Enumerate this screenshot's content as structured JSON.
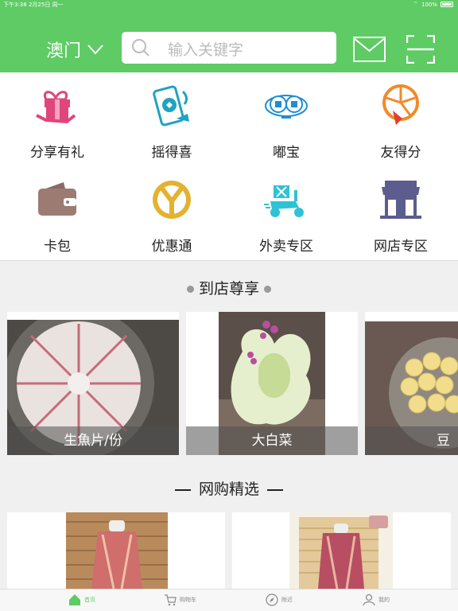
{
  "status": {
    "time": "下午3:38",
    "date": "2月25日 周一",
    "battery": "100%"
  },
  "header": {
    "city": "澳门",
    "search_placeholder": "输入关键字"
  },
  "grid": [
    {
      "label": "分享有礼",
      "icon": "gift-share-icon"
    },
    {
      "label": "摇得喜",
      "icon": "shake-phone-icon"
    },
    {
      "label": "嘟宝",
      "icon": "dobo-icon"
    },
    {
      "label": "友得分",
      "icon": "orange-slice-icon"
    },
    {
      "label": "卡包",
      "icon": "wallet-icon"
    },
    {
      "label": "优惠通",
      "icon": "yen-coin-icon"
    },
    {
      "label": "外卖专区",
      "icon": "delivery-scooter-icon"
    },
    {
      "label": "网店专区",
      "icon": "storefront-icon"
    }
  ],
  "section_store": {
    "title": "到店尊享",
    "items": [
      "生魚片/份",
      "大白菜",
      "豆皮"
    ]
  },
  "section_shop": {
    "title": "网购精选"
  },
  "tabbar": [
    {
      "label": "首页",
      "icon": "home-icon",
      "active": true
    },
    {
      "label": "购物车",
      "icon": "cart-icon",
      "active": false
    },
    {
      "label": "附近",
      "icon": "compass-icon",
      "active": false
    },
    {
      "label": "我的",
      "icon": "user-icon",
      "active": false
    }
  ],
  "colors": {
    "brand_green": "#5ecb64"
  }
}
